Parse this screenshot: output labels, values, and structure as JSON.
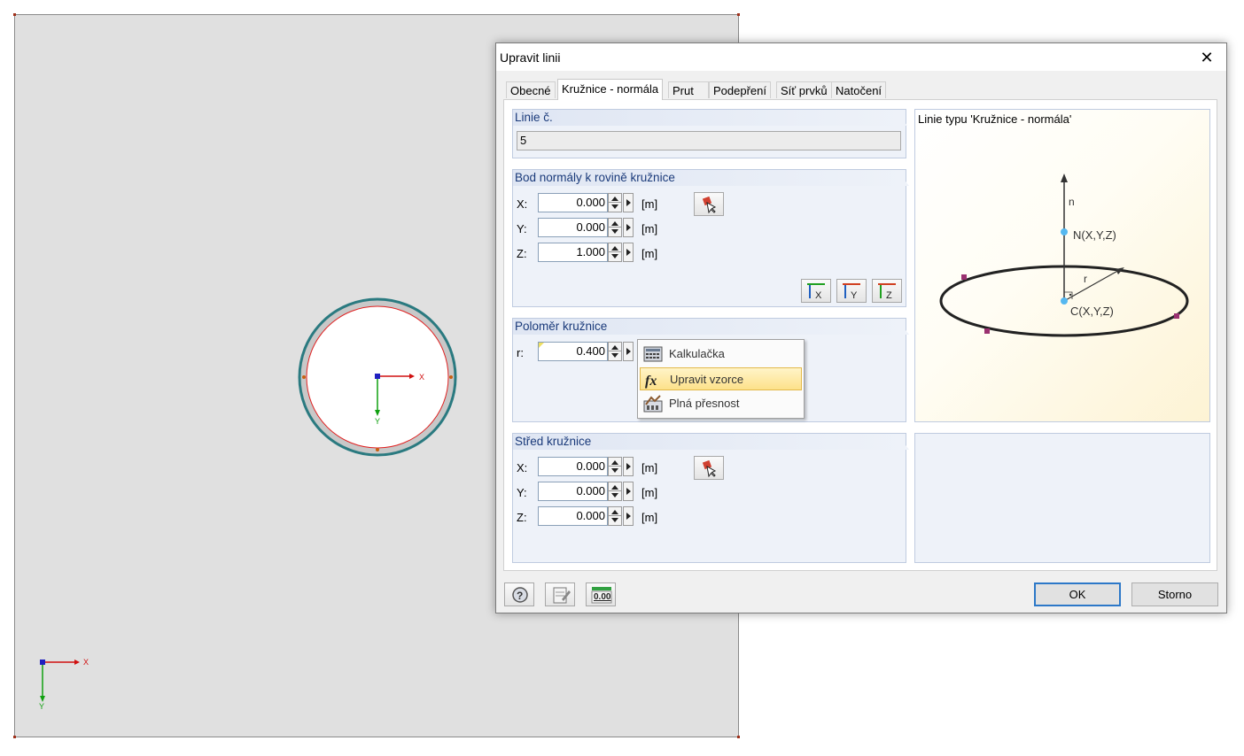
{
  "canvas": {
    "axes_main": {
      "x_label": "X",
      "y_label": "Y"
    },
    "axes_corner": {
      "x_label": "X",
      "y_label": "Y"
    }
  },
  "dialog": {
    "title": "Upravit linii",
    "close_symbol": "✕",
    "tabs": [
      {
        "label": "Obecné",
        "active": false
      },
      {
        "label": "Kružnice - normála",
        "active": true
      },
      {
        "label": "Prut",
        "active": false
      },
      {
        "label": "Podepření",
        "active": false
      },
      {
        "label": "Síť prvků",
        "active": false
      },
      {
        "label": "Natočení",
        "active": false
      }
    ],
    "line_no": {
      "header": "Linie č.",
      "value": "5"
    },
    "normal_point": {
      "header": "Bod normály k rovině kružnice",
      "x_label": "X:",
      "x_value": "0.000",
      "y_label": "Y:",
      "y_value": "0.000",
      "z_label": "Z:",
      "z_value": "1.000",
      "unit": "[m]",
      "pick_icon": "pick-point-icon",
      "axis_buttons": [
        "x-axis-icon",
        "y-axis-icon",
        "z-axis-icon"
      ]
    },
    "radius": {
      "header": "Poloměr kružnice",
      "r_label": "r:",
      "r_value": "0.400"
    },
    "center": {
      "header": "Střed kružnice",
      "x_label": "X:",
      "x_value": "0.000",
      "y_label": "Y:",
      "y_value": "0.000",
      "z_label": "Z:",
      "z_value": "0.000",
      "unit": "[m]",
      "pick_icon": "pick-point-icon"
    },
    "preview": {
      "title": "Linie typu 'Kružnice - normála'",
      "labels": {
        "n": "n",
        "n_point": "N(X,Y,Z)",
        "r": "r",
        "c_point": "C(X,Y,Z)"
      }
    },
    "context_menu": {
      "items": [
        {
          "label": "Kalkulačka",
          "icon": "calculator-icon",
          "highlighted": false
        },
        {
          "label": "Upravit vzorce",
          "icon": "formula-fx-icon",
          "highlighted": true
        },
        {
          "label": "Plná přesnost",
          "icon": "full-precision-icon",
          "highlighted": false
        }
      ]
    },
    "footer": {
      "ok_label": "OK",
      "cancel_label": "Storno",
      "tool_icons": [
        "help-icon",
        "edit-icon",
        "decimal-places-icon"
      ],
      "decimal_icon_text": "0.00"
    }
  },
  "colors": {
    "accent_blue": "#2c78c8",
    "group_header_text": "#1a3a7a",
    "circle_outline": "#2a7a80",
    "x_axis": "#d01010",
    "y_axis": "#10a010",
    "menu_highlight": "#fde18a"
  }
}
